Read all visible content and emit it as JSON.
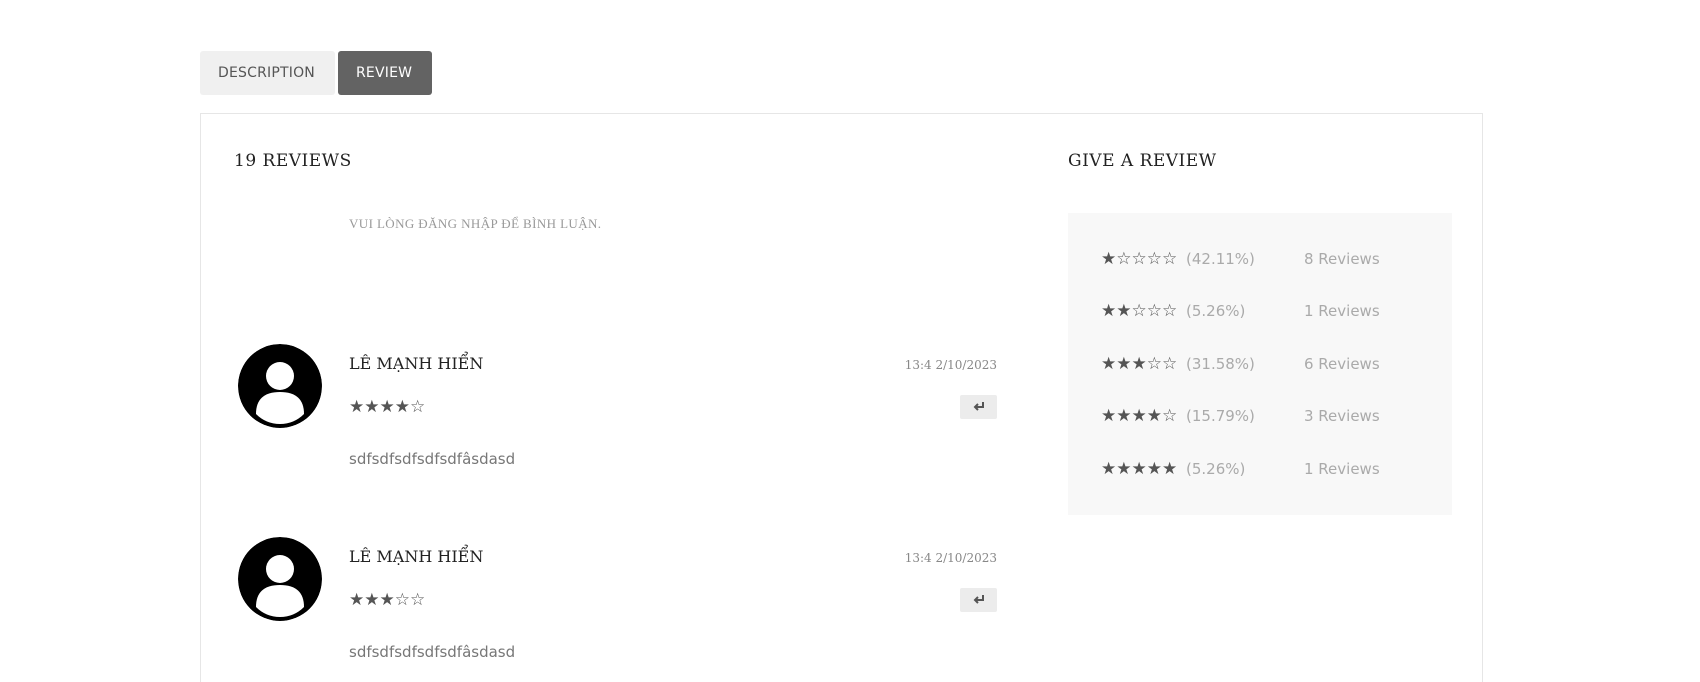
{
  "tabs": [
    {
      "label": "DESCRIPTION",
      "active": false
    },
    {
      "label": "REVIEW",
      "active": true
    }
  ],
  "reviews_section": {
    "heading": "19 REVIEWS",
    "login_note": "VUI LÒNG ĐĂNG NHẬP ĐỂ BÌNH LUẬN.",
    "reviews": [
      {
        "name": "LÊ MẠNH HIỂN",
        "date": "13:4 2/10/2023",
        "stars": "★★★★☆",
        "rating": 4,
        "text": "sdfsdfsdfsdfsdfâsdasd",
        "avatar_icon": "user-avatar-icon",
        "reply_icon": "reply-arrow-icon"
      },
      {
        "name": "LÊ MẠNH HIỂN",
        "date": "13:4 2/10/2023",
        "stars": "★★★☆☆",
        "rating": 3,
        "text": "sdfsdfsdfsdfsdfâsdasd",
        "avatar_icon": "user-avatar-icon",
        "reply_icon": "reply-arrow-icon"
      }
    ]
  },
  "give_review": {
    "heading": "GIVE A REVIEW",
    "summary": [
      {
        "stars": "★☆☆☆☆",
        "rating": 1,
        "percent": "(42.11%)",
        "count": "8 Reviews"
      },
      {
        "stars": "★★☆☆☆",
        "rating": 2,
        "percent": "(5.26%)",
        "count": "1 Reviews"
      },
      {
        "stars": "★★★☆☆",
        "rating": 3,
        "percent": "(31.58%)",
        "count": "6 Reviews"
      },
      {
        "stars": "★★★★☆",
        "rating": 4,
        "percent": "(15.79%)",
        "count": "3 Reviews"
      },
      {
        "stars": "★★★★★",
        "rating": 5,
        "percent": "(5.26%)",
        "count": "1 Reviews"
      }
    ]
  },
  "colors": {
    "tab_active_bg": "#636363",
    "tab_inactive_bg": "#f0f0f0",
    "star": "#555555",
    "summary_bg": "#f8f8f8"
  }
}
